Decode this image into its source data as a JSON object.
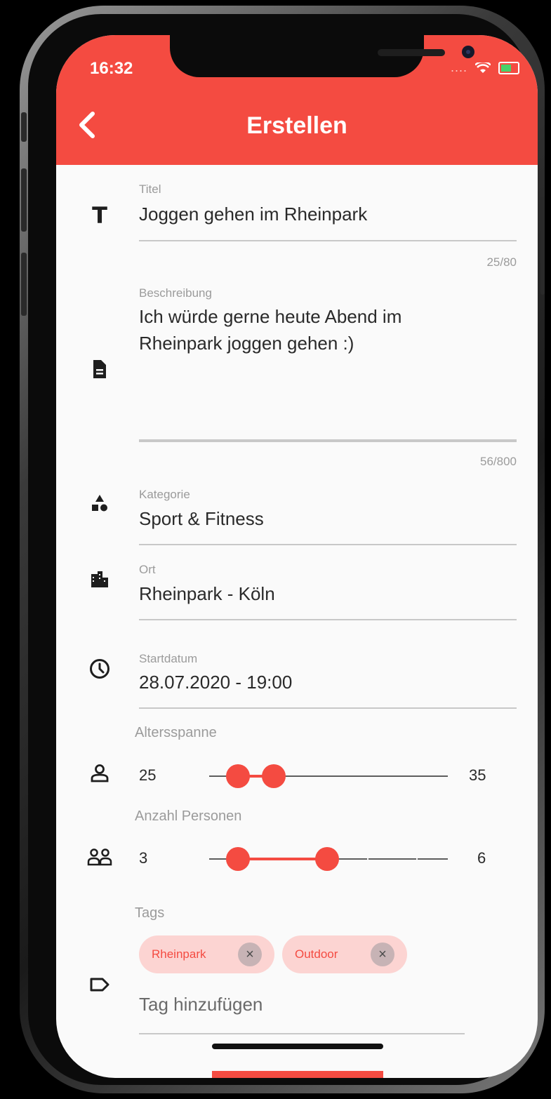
{
  "status_bar": {
    "time": "16:32",
    "signal_dots": "....",
    "wifi_icon": "wifi-icon",
    "battery_icon": "battery-icon"
  },
  "header": {
    "back_icon": "chevron-left-icon",
    "title": "Erstellen",
    "color": "#f44b41"
  },
  "form": {
    "title_field": {
      "icon": "text-icon",
      "label": "Titel",
      "value": "Joggen gehen im Rheinpark",
      "counter": "25/80"
    },
    "description_field": {
      "icon": "document-icon",
      "label": "Beschreibung",
      "value_line1": "Ich würde gerne heute Abend im",
      "value_line2": "Rheinpark joggen gehen :)",
      "counter": "56/800"
    },
    "category_field": {
      "icon": "category-shapes-icon",
      "label": "Kategorie",
      "value": "Sport & Fitness"
    },
    "location_field": {
      "icon": "city-icon",
      "label": "Ort",
      "value": "Rheinpark - Köln"
    },
    "start_date_field": {
      "icon": "clock-icon",
      "label": "Startdatum",
      "value": "28.07.2020 - 19:00"
    },
    "age_range": {
      "icon": "person-icon",
      "label": "Altersspanne",
      "min_label": "25",
      "max_label": "35",
      "range_start_fraction": 0.12,
      "range_end_fraction": 0.27
    },
    "persons": {
      "icon": "people-icon",
      "label": "Anzahl Personen",
      "min_label": "3",
      "max_label": "6",
      "range_start_fraction": 0.12,
      "range_end_fraction": 0.5
    },
    "tags": {
      "icon": "tag-icon",
      "label": "Tags",
      "chips": [
        {
          "label": "Rheinpark",
          "remove_icon": "close-icon"
        },
        {
          "label": "Outdoor",
          "remove_icon": "close-icon"
        }
      ],
      "input_placeholder": "Tag hinzufügen"
    }
  }
}
